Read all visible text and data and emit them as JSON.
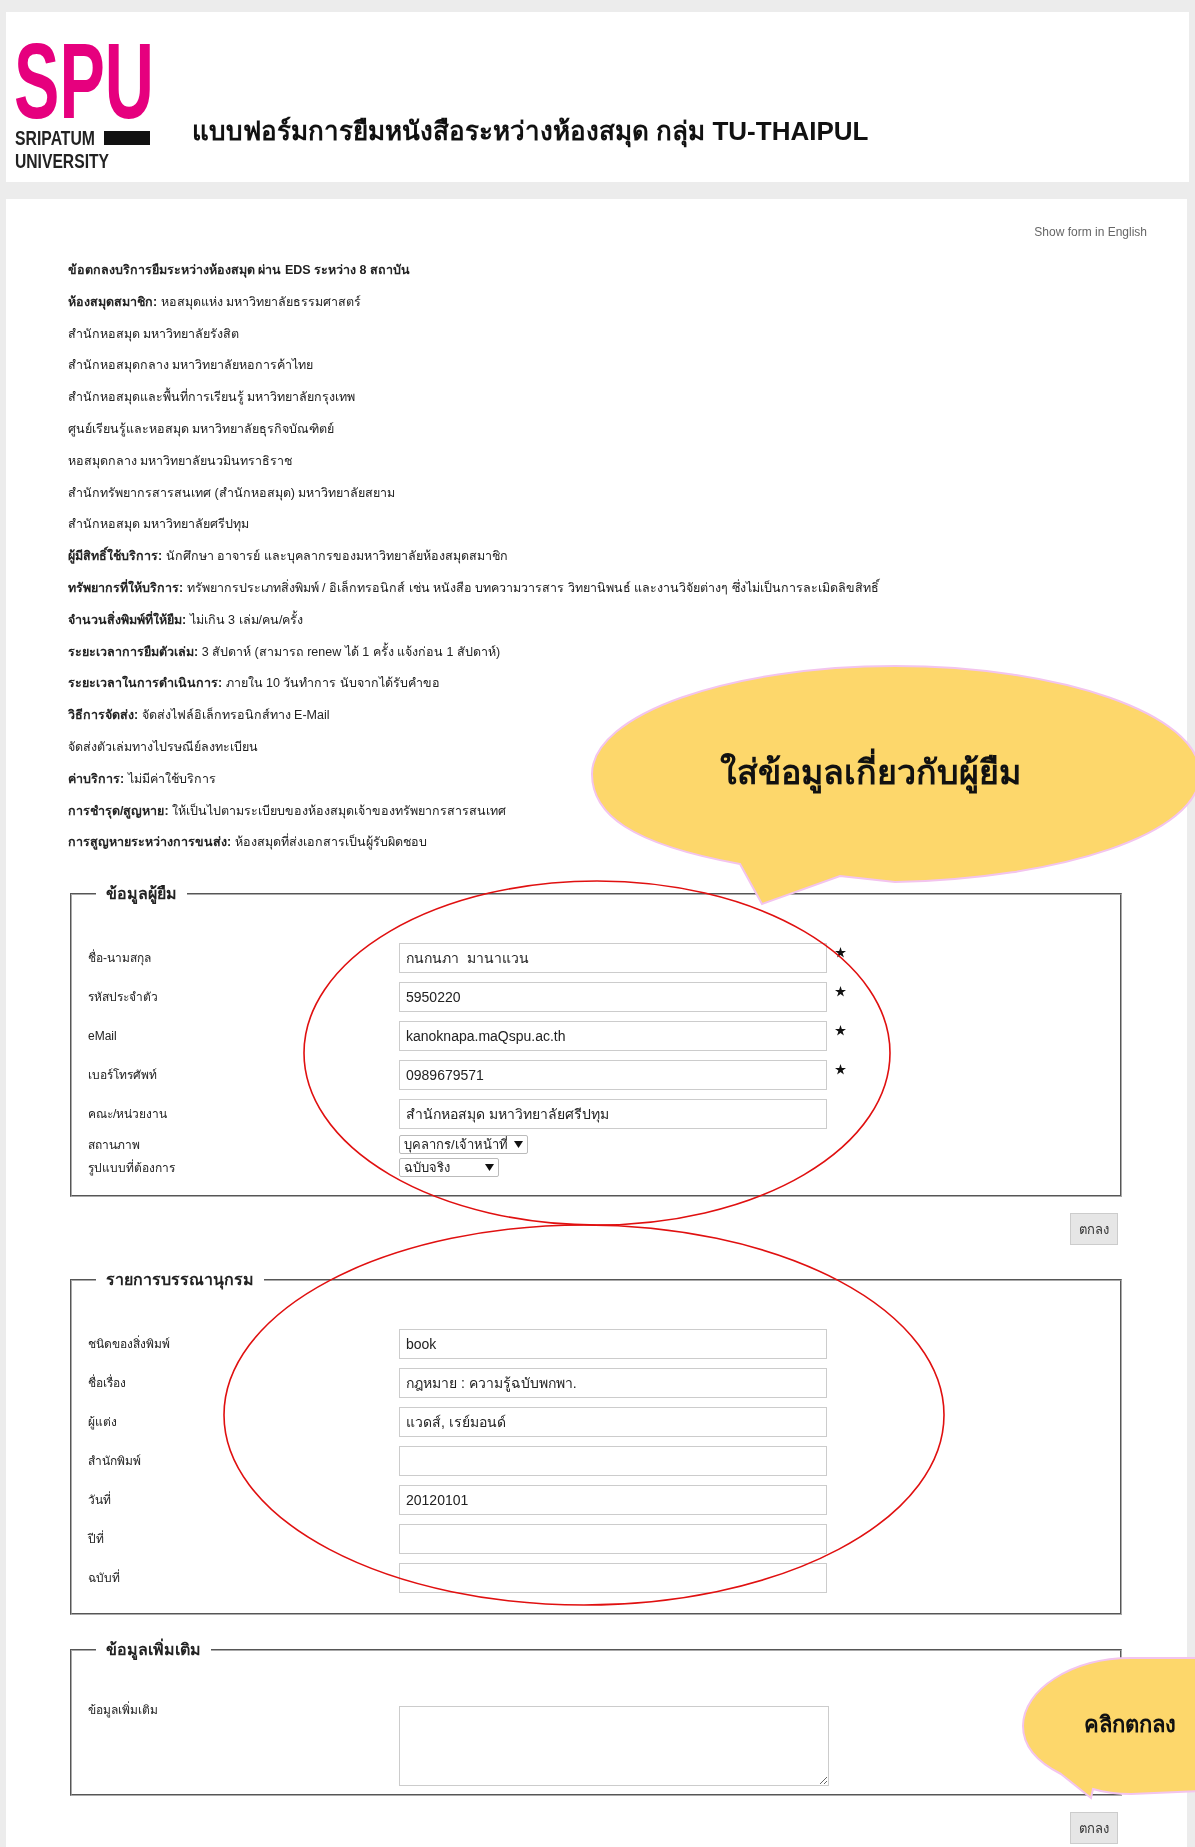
{
  "header": {
    "logo": {
      "mark": "SPU",
      "line1": "SRIPATUM",
      "line2": "UNIVERSITY"
    },
    "title": "แบบฟอร์มการยืมหนังสือระหว่างห้องสมุด กลุ่ม TU-THAIPUL"
  },
  "language_link": "Show form in English",
  "terms": [
    {
      "kind": "heading",
      "text": "ข้อตกลงบริการยืมระหว่างห้องสมุด ผ่าน EDS ระหว่าง 8 สถาบัน"
    },
    {
      "kind": "line",
      "text": "**ห้องสมุดสมาชิก:** หอสมุดแห่ง มหาวิทยาลัยธรรมศาสตร์"
    },
    {
      "kind": "line",
      "text": "สำนักหอสมุด มหาวิทยาลัยรังสิต"
    },
    {
      "kind": "line",
      "text": "สำนักหอสมุดกลาง มหาวิทยาลัยหอการค้าไทย"
    },
    {
      "kind": "line",
      "text": "สำนักหอสมุดและพื้นที่การเรียนรู้ มหาวิทยาลัยกรุงเทพ"
    },
    {
      "kind": "line",
      "text": "ศูนย์เรียนรู้และหอสมุด มหาวิทยาลัยธุรกิจบัณฑิตย์"
    },
    {
      "kind": "line",
      "text": "หอสมุดกลาง มหาวิทยาลัยนวมินทราธิราช"
    },
    {
      "kind": "line",
      "text": "สำนักทรัพยากรสารสนเทศ (สำนักหอสมุด) มหาวิทยาลัยสยาม"
    },
    {
      "kind": "line",
      "text": "สำนักหอสมุด มหาวิทยาลัยศรีปทุม"
    },
    {
      "kind": "line",
      "text": "**ผู้มีสิทธิ์ใช้บริการ:** นักศึกษา อาจารย์ และบุคลากรของมหาวิทยาลัยห้องสมุดสมาชิก"
    },
    {
      "kind": "line",
      "text": "**ทรัพยากรที่ให้บริการ:** ทรัพยากรประเภทสิ่งพิมพ์ / อิเล็กทรอนิกส์ เช่น หนังสือ บทความวารสาร วิทยานิพนธ์ และงานวิจัยต่างๆ ซึ่งไม่เป็นการละเมิดลิขสิทธิ์"
    },
    {
      "kind": "line",
      "text": "**จำนวนสิ่งพิมพ์ที่ให้ยืม:** ไม่เกิน 3 เล่ม/คน/ครั้ง"
    },
    {
      "kind": "line",
      "text": "**ระยะเวลาการยืมตัวเล่ม:** 3 สัปดาห์ (สามารถ renew ได้ 1 ครั้ง แจ้งก่อน 1 สัปดาห์)"
    },
    {
      "kind": "line",
      "text": "**ระยะเวลาในการดำเนินการ:** ภายใน 10 วันทำการ นับจากได้รับคำขอ"
    },
    {
      "kind": "line",
      "text": "**วิธีการจัดส่ง:** จัดส่งไฟล์อิเล็กทรอนิกส์ทาง E-Mail"
    },
    {
      "kind": "line",
      "text": "จัดส่งตัวเล่มทางไปรษณีย์ลงทะเบียน"
    },
    {
      "kind": "line",
      "text": "**ค่าบริการ:** ไม่มีค่าใช้บริการ"
    },
    {
      "kind": "line",
      "text": "**การชำรุด/สูญหาย:** ให้เป็นไปตามระเบียบของห้องสมุดเจ้าของทรัพยากรสารสนเทศ"
    },
    {
      "kind": "line",
      "text": "**การสูญหายระหว่างการขนส่ง:** ห้องสมุดที่ส่งเอกสารเป็นผู้รับผิดชอบ"
    }
  ],
  "sections": [
    {
      "legend": "ข้อมูลผู้ยืม",
      "submit": "ตกลง",
      "fields": [
        {
          "kind": "text",
          "label": "ชื่อ-นามสกุล",
          "value": "กนกนภา  มานาแวน",
          "required": true
        },
        {
          "kind": "text",
          "label": "รหัสประจำตัว",
          "value": "5950220",
          "required": true
        },
        {
          "kind": "text",
          "label": "eMail",
          "value": "kanoknapa.maQspu.ac.th",
          "required": true
        },
        {
          "kind": "text",
          "label": "เบอร์โทรศัพท์",
          "value": "0989679571",
          "required": true
        },
        {
          "kind": "text",
          "label": "คณะ/หน่วยงาน",
          "value": "สำนักหอสมุด มหาวิทยาลัยศรีปทุม",
          "required": false
        },
        {
          "kind": "select",
          "label": "สถานภาพ",
          "value": "บุคลากร/เจ้าหน้าที่"
        },
        {
          "kind": "select",
          "label": "รูปแบบที่ต้องการ",
          "value": "ฉบับจริง"
        }
      ]
    },
    {
      "legend": "รายการบรรณานุกรม",
      "fields": [
        {
          "kind": "text",
          "label": "ชนิดของสิ่งพิมพ์",
          "value": "book",
          "required": false
        },
        {
          "kind": "text",
          "label": "ชื่อเรื่อง",
          "value": "กฎหมาย : ความรู้ฉบับพกพา.",
          "required": false
        },
        {
          "kind": "text",
          "label": "ผู้แต่ง",
          "value": "แวดส์, เรย์มอนด์",
          "required": false
        },
        {
          "kind": "text",
          "label": "สำนักพิมพ์",
          "required": false
        },
        {
          "kind": "text",
          "label": "วันที่",
          "value": "20120101",
          "required": false
        },
        {
          "kind": "text",
          "label": "ปีที่",
          "required": false
        },
        {
          "kind": "text",
          "label": "ฉบับที่",
          "required": false
        }
      ]
    },
    {
      "legend": "ข้อมูลเพิ่มเติม",
      "submit": "ตกลง",
      "fields": [
        {
          "kind": "textarea",
          "label": "ข้อมูลเพิ่มเติม"
        }
      ]
    }
  ],
  "callouts": [
    {
      "text": "ใส่ข้อมูลเกี่ยวกับผู้ยืม"
    },
    {
      "text": "คลิกตกลง"
    }
  ]
}
